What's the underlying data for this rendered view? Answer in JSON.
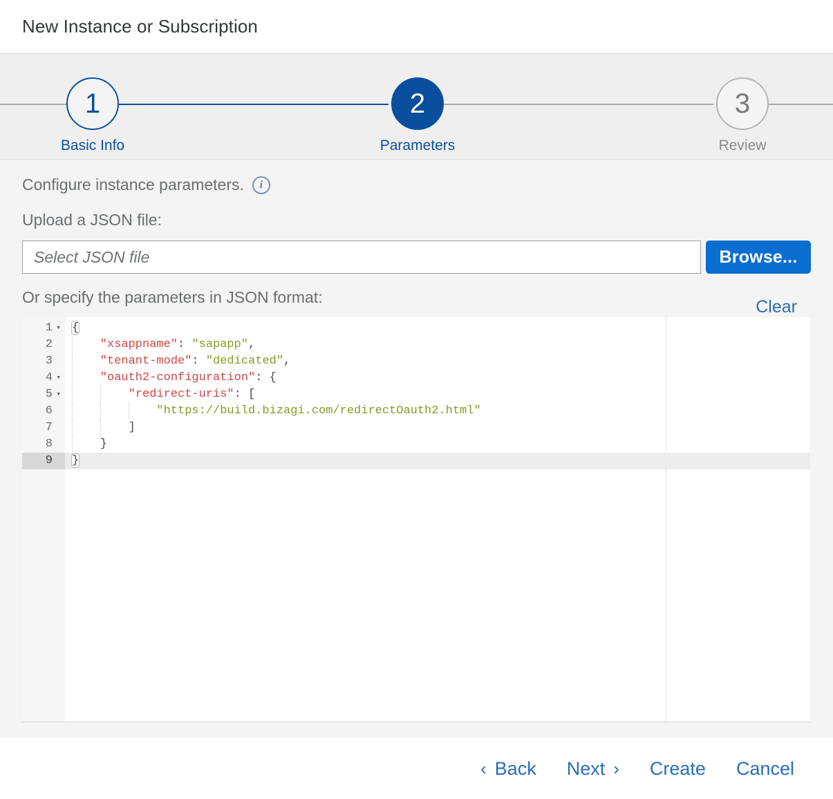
{
  "window": {
    "title": "New Instance or Subscription"
  },
  "wizard": {
    "steps": [
      {
        "number": "1",
        "label": "Basic Info",
        "state": "pending"
      },
      {
        "number": "2",
        "label": "Parameters",
        "state": "active"
      },
      {
        "number": "3",
        "label": "Review",
        "state": "future"
      }
    ]
  },
  "main": {
    "configure_text": "Configure instance parameters.",
    "info_icon_glyph": "i",
    "upload_label": "Upload a JSON file:",
    "file_input_placeholder": "Select JSON file",
    "file_input_value": "",
    "browse_label": "Browse...",
    "json_label": "Or specify the parameters in JSON format:",
    "clear_label": "Clear"
  },
  "editor": {
    "active_line": 9,
    "line_numbers": [
      "1",
      "2",
      "3",
      "4",
      "5",
      "6",
      "7",
      "8",
      "9"
    ],
    "fold_arrows": [
      1,
      4,
      5
    ],
    "fold_glyph": "▾",
    "lines": [
      {
        "n": 1,
        "indent": 0,
        "tokens": [
          {
            "t": "{",
            "c": "punc",
            "box": true
          }
        ]
      },
      {
        "n": 2,
        "indent": 1,
        "tokens": [
          {
            "t": "\"xsappname\"",
            "c": "key"
          },
          {
            "t": ": ",
            "c": "punc"
          },
          {
            "t": "\"sapapp\"",
            "c": "str"
          },
          {
            "t": ",",
            "c": "punc"
          }
        ]
      },
      {
        "n": 3,
        "indent": 1,
        "tokens": [
          {
            "t": "\"tenant-mode\"",
            "c": "key"
          },
          {
            "t": ": ",
            "c": "punc"
          },
          {
            "t": "\"dedicated\"",
            "c": "str"
          },
          {
            "t": ",",
            "c": "punc"
          }
        ]
      },
      {
        "n": 4,
        "indent": 1,
        "tokens": [
          {
            "t": "\"oauth2-configuration\"",
            "c": "key"
          },
          {
            "t": ": {",
            "c": "punc"
          }
        ]
      },
      {
        "n": 5,
        "indent": 2,
        "tokens": [
          {
            "t": "\"redirect-uris\"",
            "c": "key"
          },
          {
            "t": ": [",
            "c": "punc"
          }
        ]
      },
      {
        "n": 6,
        "indent": 3,
        "tokens": [
          {
            "t": "\"https://build.bizagi.com/redirectOauth2.html\"",
            "c": "str"
          }
        ]
      },
      {
        "n": 7,
        "indent": 2,
        "tokens": [
          {
            "t": "]",
            "c": "punc"
          }
        ]
      },
      {
        "n": 8,
        "indent": 1,
        "tokens": [
          {
            "t": "}",
            "c": "punc"
          }
        ]
      },
      {
        "n": 9,
        "indent": 0,
        "tokens": [
          {
            "t": "}",
            "c": "punc",
            "box": true
          }
        ]
      }
    ],
    "json_text": "{\n    \"xsappname\": \"sapapp\",\n    \"tenant-mode\": \"dedicated\",\n    \"oauth2-configuration\": {\n        \"redirect-uris\": [\n            \"https://build.bizagi.com/redirectOauth2.html\"\n        ]\n    }\n}"
  },
  "footer": {
    "back_label": "Back",
    "back_chevron": "‹",
    "next_label": "Next",
    "next_chevron": "›",
    "create_label": "Create",
    "cancel_label": "Cancel"
  },
  "colors": {
    "accent_blue": "#0a6ed1",
    "link_blue": "#2a6eb5",
    "step_blue": "#0a4f9e",
    "json_key": "#d14545",
    "json_string": "#8a9a25",
    "content_bg": "#f4f4f4",
    "stepbar_bg": "#efefef"
  }
}
